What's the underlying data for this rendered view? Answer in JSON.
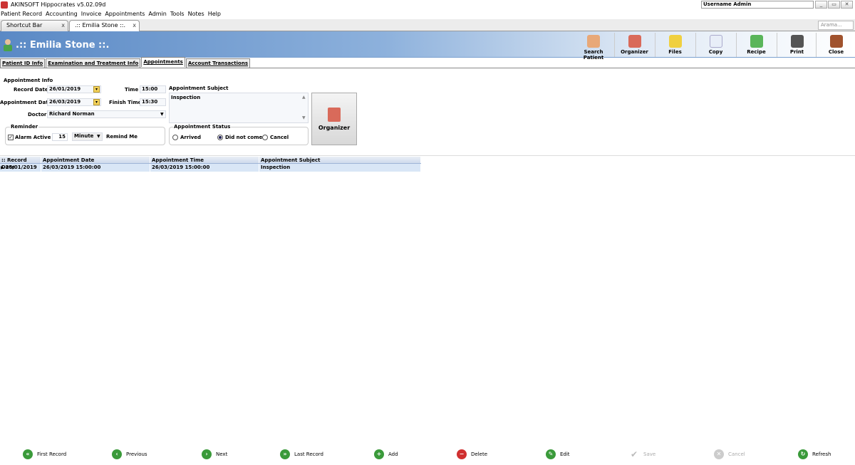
{
  "window": {
    "title": "AKINSOFT Hippocrates v5.02.09d",
    "user": "Username Admin"
  },
  "menu": [
    "Patient Record",
    "Accounting",
    "Invoice",
    "Appointments",
    "Admin",
    "Tools",
    "Notes",
    "Help"
  ],
  "doc_tabs": [
    {
      "label": "Shortcut Bar"
    },
    {
      "label": ".:: Emilia Stone ::."
    }
  ],
  "search_placeholder": "Arama...",
  "patient_name": ".:: Emilia Stone ::.",
  "toolbar": [
    {
      "label": "Search Patient",
      "icon": "search-patient-icon"
    },
    {
      "label": "Organizer",
      "icon": "calendar-icon"
    },
    {
      "label": "Files",
      "icon": "files-icon"
    },
    {
      "label": "Copy",
      "icon": "copy-icon"
    },
    {
      "label": "Recipe",
      "icon": "recipe-icon"
    },
    {
      "label": "Print",
      "icon": "printer-icon"
    },
    {
      "label": "Close",
      "icon": "close-door-icon"
    }
  ],
  "subtabs": [
    "Patient ID Info",
    "Examination and Treatment Info",
    "Appointments",
    "Account Transactions"
  ],
  "form": {
    "section_title": "Appointment Info",
    "record_date_label": "Record Date",
    "record_date": "26/01/2019",
    "appointment_date_label": "Appointment Date",
    "appointment_date": "26/03/2019",
    "time_label": "Time",
    "time": "15:00",
    "finish_time_label": "Finish Time",
    "finish_time": "15:30",
    "doctor_label": "Doctor",
    "doctor": "Richard Norman",
    "subject_label": "Appointment Subject",
    "subject": "Inspection",
    "reminder_title": "Reminder",
    "alarm_active_label": "Alarm Active",
    "alarm_active": true,
    "reminder_amount": "15",
    "reminder_unit": "Minute",
    "remind_me_label": "Remind Me",
    "status_title": "Appointment Status",
    "status_options": [
      "Arrived",
      "Did not come",
      "Cancel"
    ],
    "status_selected": "Did not come",
    "organizer_button": "Organizer"
  },
  "grid": {
    "columns": [
      ":: Record Date",
      "Appointment Date",
      "Appointment Time",
      "Appointment Subject"
    ],
    "rows": [
      [
        "26/01/2019",
        "26/03/2019 15:00:00",
        "26/03/2019 15:00:00",
        "Inspection"
      ]
    ]
  },
  "nav": {
    "first": "First Record",
    "previous": "Previous",
    "next": "Next",
    "last": "Last Record",
    "add": "Add",
    "delete": "Delete",
    "edit": "Edit",
    "save": "Save",
    "cancel": "Cancel",
    "refresh": "Refresh"
  },
  "colors": {
    "header_blue": "#5a89c5",
    "nav_green": "#3a9a3a",
    "delete_red": "#d03030"
  }
}
